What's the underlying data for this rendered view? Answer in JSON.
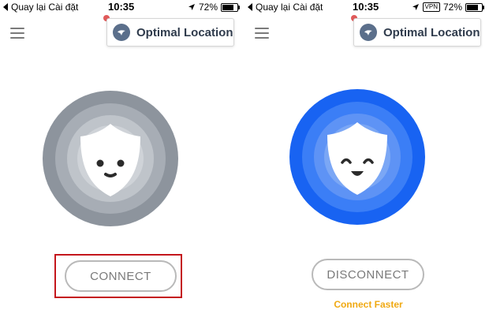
{
  "statusbar": {
    "back_label": "Quay lại Cài đặt",
    "time": "10:35",
    "battery": "72%",
    "vpn_badge": "VPN",
    "battery_level": 0.72
  },
  "header": {
    "location_label": "Optimal Location"
  },
  "screens": {
    "left": {
      "state": "disconnected",
      "button_label": "CONNECT",
      "orb_color": "#8d949d"
    },
    "right": {
      "state": "connected",
      "button_label": "DISCONNECT",
      "orb_color": "#1863f2",
      "hint": "Connect Faster",
      "hint_color": "#f0a912"
    }
  },
  "icons": [
    "location-arrow-icon",
    "menu-icon",
    "globe-icon",
    "shield-face-icon"
  ]
}
